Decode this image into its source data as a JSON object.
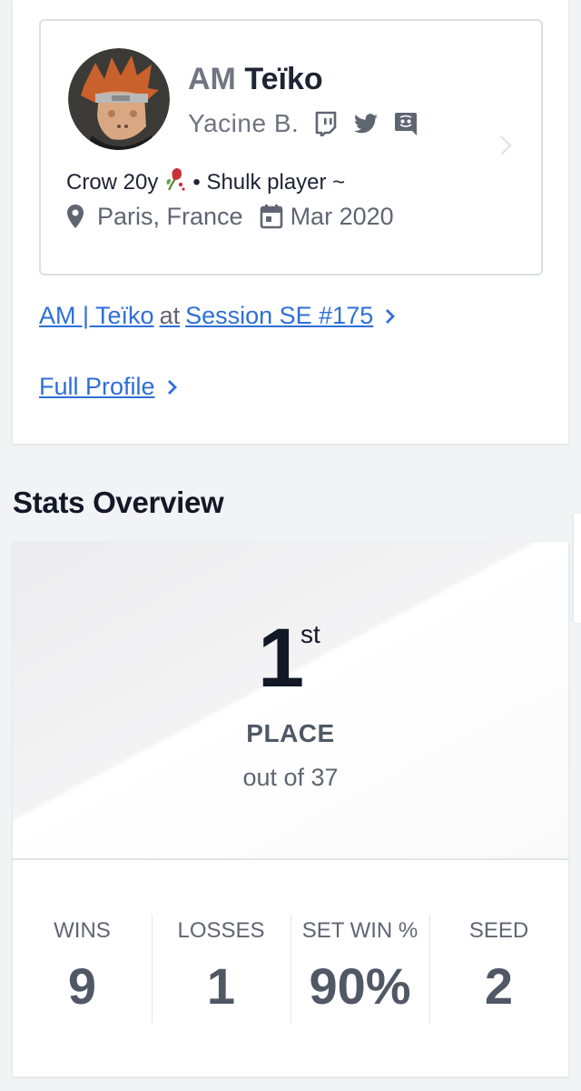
{
  "player": {
    "prefix": "AM",
    "gamertag": "Teïko",
    "real_name": "Yacine B.",
    "bio_before_emoji": "Crow 20y",
    "bio_after_emoji": "• Shulk player ~",
    "location": "Paris, France",
    "joined": "Mar 2020",
    "social_icons": [
      "twitch-icon",
      "twitter-icon",
      "discord-icon"
    ]
  },
  "links": {
    "entrant_name": "AM | Teïko",
    "at_word": "at",
    "event_name": "Session SE #175",
    "full_profile": "Full Profile"
  },
  "stats": {
    "section_title": "Stats Overview",
    "place_number": "1",
    "place_suffix": "st",
    "place_label": "PLACE",
    "out_of": "out of 37",
    "columns": [
      {
        "label": "WINS",
        "value": "9"
      },
      {
        "label": "LOSSES",
        "value": "1"
      },
      {
        "label": "SET WIN %",
        "value": "90%"
      },
      {
        "label": "SEED",
        "value": "2"
      }
    ]
  },
  "colors": {
    "link": "#2f6fd6",
    "text_dark": "#121826",
    "text_muted": "#5f6672"
  }
}
